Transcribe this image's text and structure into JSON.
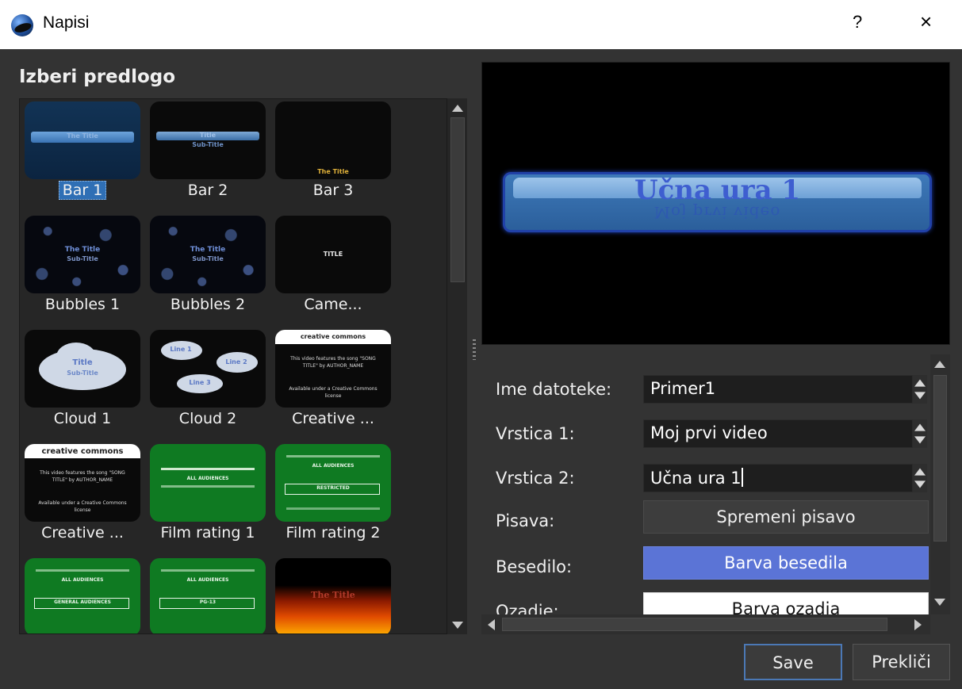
{
  "window": {
    "title": "Napisi",
    "help_label": "?",
    "close_label": "×"
  },
  "left": {
    "heading": "Izberi predlogo",
    "templates": [
      {
        "label": "Bar 1",
        "thumb_text": "The Title",
        "selected": true
      },
      {
        "label": "Bar 2",
        "thumb_text": "Title",
        "thumb_sub": "Sub-Title"
      },
      {
        "label": "Bar 3",
        "thumb_text": "The Title"
      },
      {
        "label": "Bubbles 1",
        "thumb_text": "The Title",
        "thumb_sub": "Sub-Title"
      },
      {
        "label": "Bubbles 2",
        "thumb_text": "The Title",
        "thumb_sub": "Sub-Title"
      },
      {
        "label": "Came...",
        "thumb_text": "TITLE"
      },
      {
        "label": "Cloud 1",
        "thumb_text": "Title",
        "thumb_sub": "Sub-Title"
      },
      {
        "label": "Cloud 2",
        "thumb_text": "Line 1",
        "thumb_sub": "Line 2",
        "thumb_extra": "Line 3"
      },
      {
        "label": "Creative ...",
        "thumb_text": "creative commons",
        "thumb_sub": "This video features the song \"SONG TITLE\" by AUTHOR_NAME",
        "thumb_extra": "Available under a Creative Commons license"
      },
      {
        "label": "Creative ...",
        "thumb_text": "creative commons",
        "thumb_sub": "This video features the song \"SONG TITLE\" by AUTHOR_NAME",
        "thumb_extra": "Available under a Creative Commons license"
      },
      {
        "label": "Film rating 1",
        "thumb_text": "ALL AUDIENCES"
      },
      {
        "label": "Film rating 2",
        "thumb_text": "ALL AUDIENCES",
        "thumb_sub": "RESTRICTED"
      },
      {
        "label": "",
        "thumb_text": "ALL AUDIENCES",
        "thumb_sub": "GENERAL AUDIENCES"
      },
      {
        "label": "",
        "thumb_text": "ALL AUDIENCES",
        "thumb_sub": "PG-13"
      },
      {
        "label": "",
        "thumb_text": "The Title"
      }
    ]
  },
  "preview": {
    "title": "Učna ura 1",
    "subtitle": "Moj prvi video"
  },
  "form": {
    "filename_label": "Ime datoteke:",
    "filename_value": "Primer1",
    "line1_label": "Vrstica 1:",
    "line1_value": "Moj prvi video",
    "line2_label": "Vrstica 2:",
    "line2_value": "Učna ura 1",
    "font_label": "Pisava:",
    "font_button": "Spremeni pisavo",
    "text_label": "Besedilo:",
    "text_button": "Barva besedila",
    "bg_label": "Ozadje:",
    "bg_button": "Barva ozadja"
  },
  "buttons": {
    "save": "Save",
    "cancel": "Prekliči"
  },
  "colors": {
    "accent": "#5b74d6",
    "selection": "#2f6fb5",
    "rating_green": "#0f7a22"
  }
}
